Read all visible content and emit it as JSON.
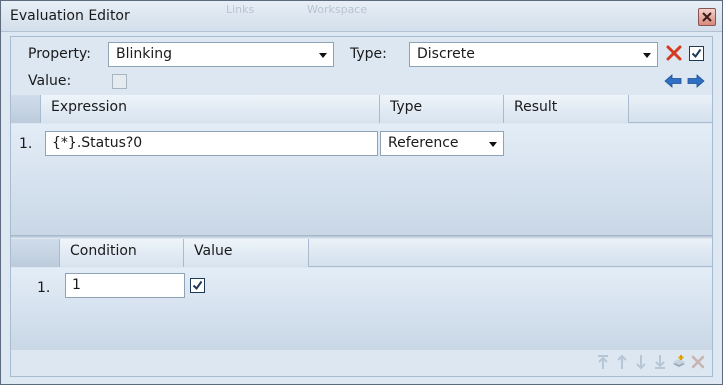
{
  "window": {
    "title": "Evaluation Editor",
    "ghost_tab_1": "Links",
    "ghost_tab_2": "Workspace"
  },
  "form": {
    "property_label": "Property:",
    "property_value": "Blinking",
    "type_label": "Type:",
    "type_value": "Discrete",
    "value_label": "Value:",
    "value_checked": false,
    "enabled_checked": true
  },
  "expression_grid": {
    "columns": [
      "Expression",
      "Type",
      "Result"
    ],
    "rows": [
      {
        "num": "1.",
        "expression": "{*}.Status?0",
        "type": "Reference"
      }
    ]
  },
  "condition_grid": {
    "columns": [
      "Condition",
      "Value"
    ],
    "rows": [
      {
        "num": "1.",
        "condition": "1",
        "value_checked": true
      }
    ]
  },
  "icons": {
    "delete": "delete-x-icon",
    "back": "arrow-left-icon",
    "forward": "arrow-right-icon",
    "move_top": "move-to-top-icon",
    "move_up": "move-up-icon",
    "move_down": "move-down-icon",
    "move_bottom": "move-to-bottom-icon",
    "add": "add-condition-icon",
    "remove": "remove-condition-icon"
  },
  "colors": {
    "accent_blue": "#2f6fc4",
    "delete_red": "#d43a1f"
  }
}
